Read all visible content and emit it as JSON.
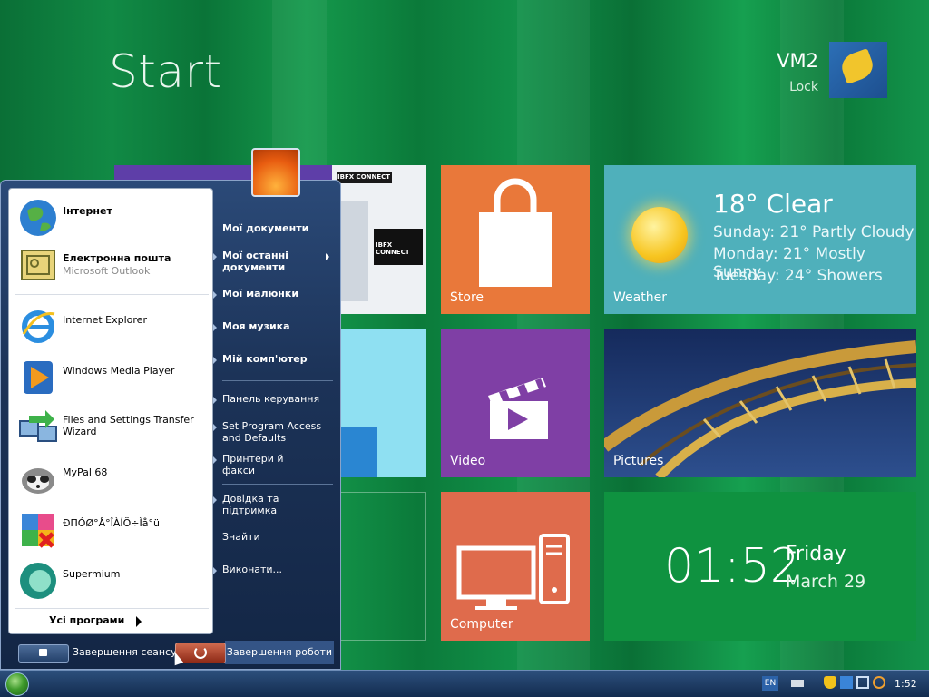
{
  "start_screen": {
    "title": "Start",
    "user": {
      "name": "VM2",
      "lock_label": "Lock"
    },
    "tiles": {
      "store": {
        "label": "Store"
      },
      "weather": {
        "label": "Weather",
        "current": "18° Clear",
        "forecast": [
          "Sunday: 21° Partly Cloudy",
          "Monday: 21° Mostly Sunny",
          "Tuesday: 24° Showers"
        ]
      },
      "video": {
        "label": "Video"
      },
      "pictures": {
        "label": "Pictures"
      },
      "computer": {
        "label": "Computer"
      },
      "clock": {
        "time": "01:52",
        "day": "Friday",
        "date": "March 29"
      },
      "ie_preview": {
        "brand": "IBFX CONNECT"
      }
    }
  },
  "start_menu": {
    "pinned": [
      {
        "label": "Інтернет",
        "sublabel": "",
        "icon": "globe-icon",
        "bold": true
      },
      {
        "label": "Електронна пошта",
        "sublabel": "Microsoft Outlook",
        "icon": "outlook-icon",
        "bold": true
      }
    ],
    "recent": [
      {
        "label": "Internet Explorer",
        "icon": "ie-icon"
      },
      {
        "label": "Windows Media Player",
        "icon": "media-player-icon"
      },
      {
        "label": "Files and Settings Transfer Wizard",
        "icon": "transfer-wizard-icon"
      },
      {
        "label": "MyPal 68",
        "icon": "mypal-icon"
      },
      {
        "label": "ÐΠÓØ°Å°ÎÀÍÖ÷Ìå°ü",
        "icon": "broken-app-icon"
      },
      {
        "label": "Supermium",
        "icon": "supermium-icon"
      }
    ],
    "all_programs": "Усі програми",
    "right": [
      {
        "label": "Мої документи",
        "bold": true,
        "submenu": false
      },
      {
        "label": "Мої останні документи",
        "bold": true,
        "submenu": true
      },
      {
        "label": "Мої малюнки",
        "bold": true,
        "submenu": false
      },
      {
        "label": "Моя музика",
        "bold": true,
        "submenu": false
      },
      {
        "label": "Мій комп'ютер",
        "bold": true,
        "submenu": false
      },
      {
        "label": "Панель керування",
        "bold": false,
        "submenu": false
      },
      {
        "label": "Set Program Access and Defaults",
        "bold": false,
        "submenu": false
      },
      {
        "label": "Принтери й факси",
        "bold": false,
        "submenu": false
      },
      {
        "label": "Довідка та підтримка",
        "bold": false,
        "submenu": false
      },
      {
        "label": "Знайти",
        "bold": false,
        "submenu": false
      },
      {
        "label": "Виконати...",
        "bold": false,
        "submenu": false
      }
    ],
    "logoff_label": "Завершення сеансу",
    "shutdown_label": "Завершення роботи"
  },
  "taskbar": {
    "lang": "EN",
    "clock": "1:52"
  },
  "colors": {
    "bg_green": "#0b7a3a",
    "store": "#e9783a",
    "weather": "#4fb0bb",
    "video": "#7f3fa5",
    "computer": "#df6b4c",
    "clock": "#0f9240"
  }
}
